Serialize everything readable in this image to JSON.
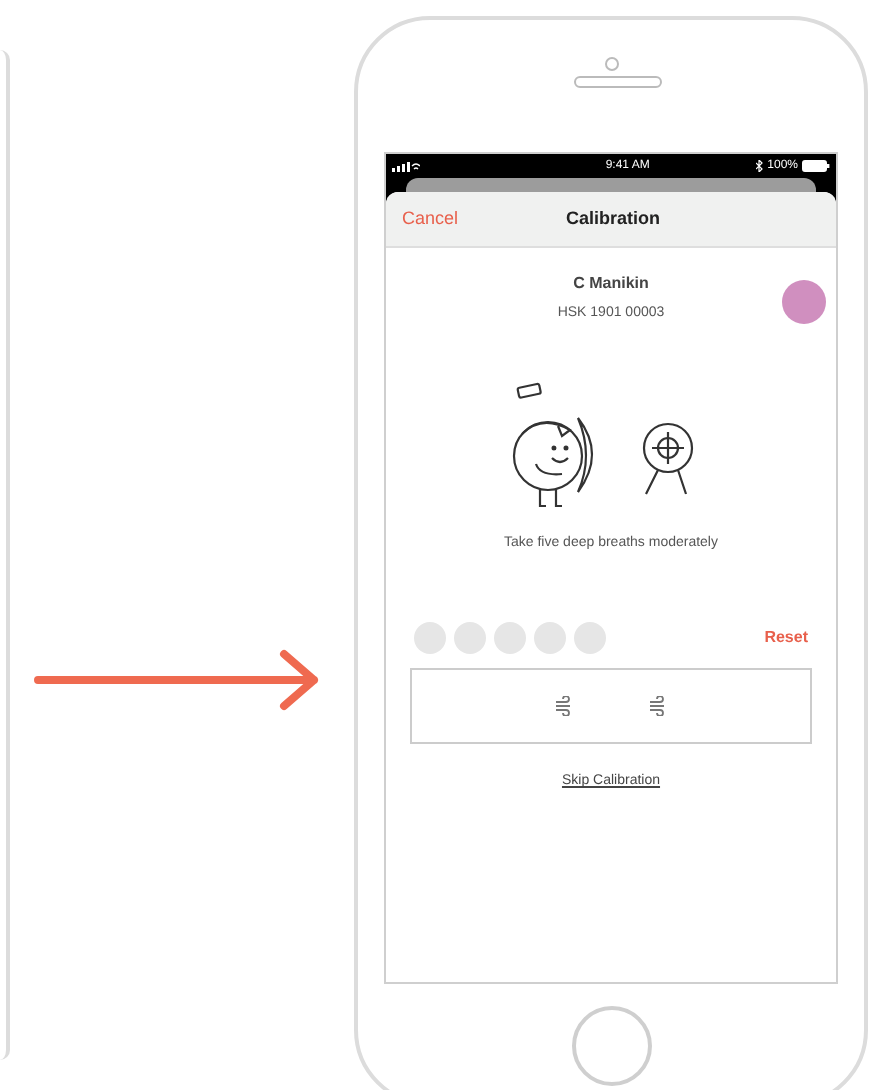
{
  "status_bar": {
    "time": "9:41 AM",
    "battery": "100%"
  },
  "header": {
    "cancel": "Cancel",
    "title": "Calibration"
  },
  "device": {
    "name": "C Manikin",
    "serial": "HSK 1901 00003",
    "color": "#d08fbf"
  },
  "instruction": "Take five deep breaths moderately",
  "breaths": [
    {
      "done": false
    },
    {
      "done": false
    },
    {
      "done": false
    },
    {
      "done": false
    },
    {
      "done": false
    }
  ],
  "reset": "Reset",
  "skip": "Skip Calibration"
}
